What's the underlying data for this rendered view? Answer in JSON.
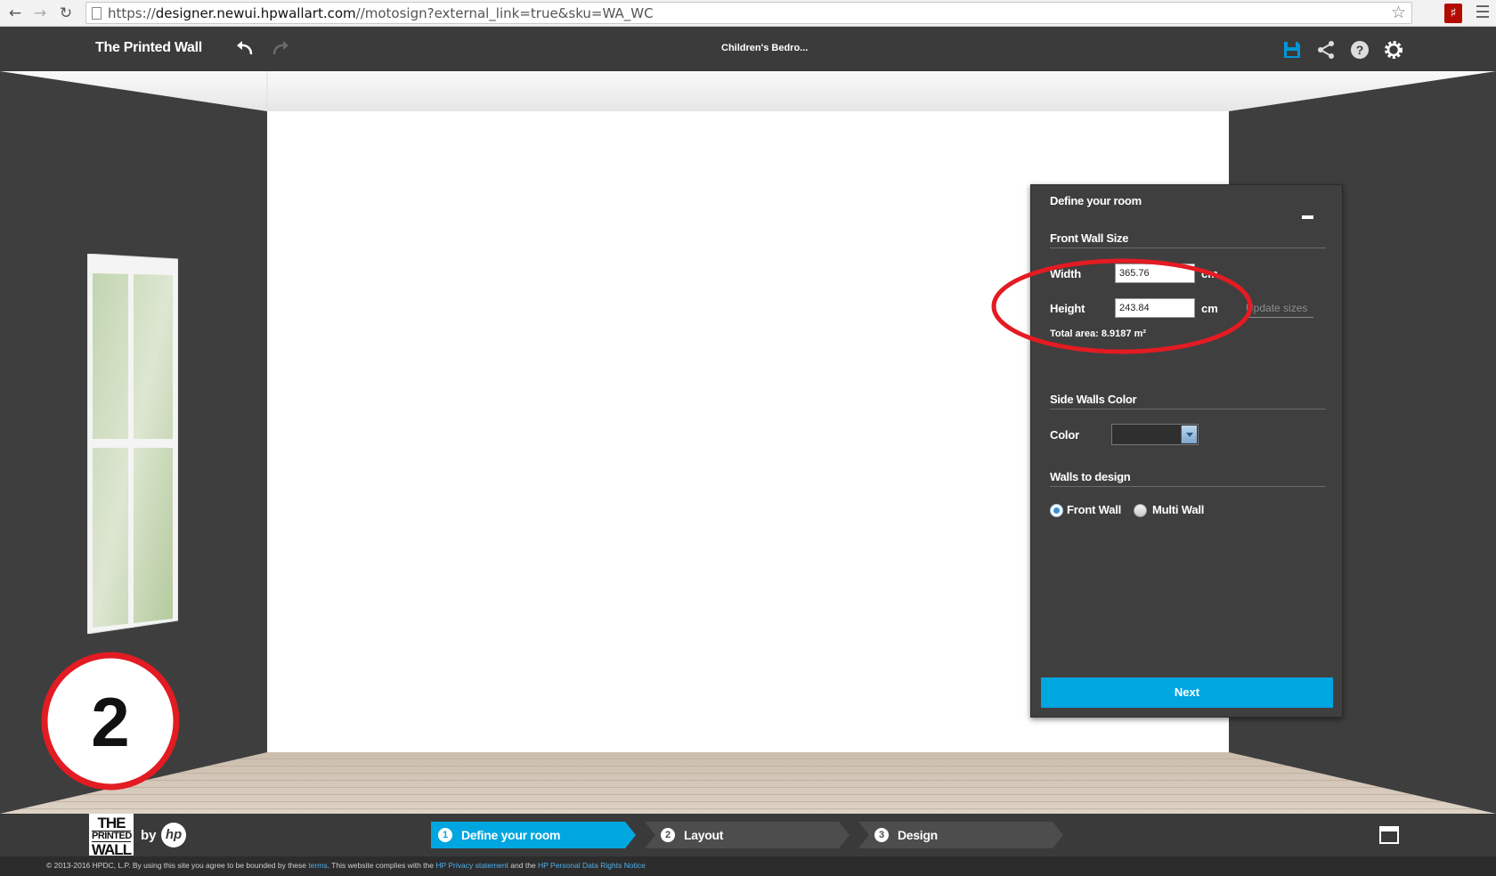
{
  "browser": {
    "url_prefix": "https://",
    "url_host": "designer.newui.hpwallart.com",
    "url_path": "//motosign?external_link=true&sku=WA_WC",
    "back_icon": "back-arrow-icon",
    "forward_icon": "forward-arrow-icon",
    "reload_icon": "reload-icon",
    "star_icon": "bookmark-star-icon",
    "pdf_icon": "pdf-extension-icon"
  },
  "header": {
    "title": "The Printed Wall",
    "project_name": "Children's Bedro...",
    "icons": [
      "undo-icon",
      "redo-icon",
      "save-icon",
      "share-icon",
      "help-icon",
      "settings-gear-icon"
    ],
    "save_color": "#0096d6"
  },
  "panel": {
    "title": "Define your room",
    "front_wall_section": "Front Wall Size",
    "width_label": "Width",
    "width_value": "365.76",
    "width_unit": "cm.",
    "height_label": "Height",
    "height_value": "243.84",
    "height_unit": "cm",
    "update_sizes": "Update sizes",
    "total_area": "Total area: 8.9187 m²",
    "side_walls_section": "Side Walls Color",
    "color_label": "Color",
    "walls_to_design_section": "Walls to design",
    "radio_front": "Front Wall",
    "radio_multi": "Multi Wall",
    "radio_selected": "Front Wall",
    "next_button": "Next",
    "accent_color": "#00a6e0"
  },
  "annotation": {
    "step_number": "2",
    "color": "#e31b23"
  },
  "steps": [
    {
      "num": "1",
      "label": "Define your room",
      "active": true
    },
    {
      "num": "2",
      "label": "Layout",
      "active": false
    },
    {
      "num": "3",
      "label": "Design",
      "active": false
    }
  ],
  "brand": {
    "logo_line1": "THE",
    "logo_line2": "PRINTED",
    "logo_line3": "WALL",
    "by": "by",
    "hp": "hp"
  },
  "footer": {
    "copyright": "© 2013-2016 HPDC, L.P.  By using this site you agree to be bounded by these ",
    "terms_link": "terms",
    "middle": ". This website complies with the ",
    "privacy_link": "HP Privacy statement",
    "and_the": " and the ",
    "rights_link": "HP Personal Data Rights Notice"
  }
}
